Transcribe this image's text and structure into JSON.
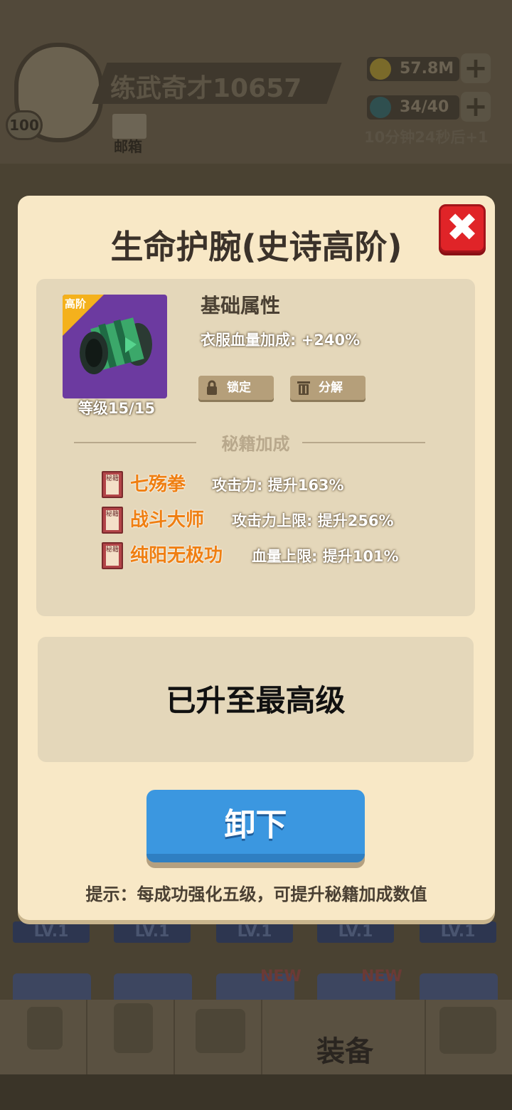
{
  "hud": {
    "player_name": "练武奇才10657",
    "level": "100",
    "mail_label": "邮箱",
    "coins": "57.8M",
    "energy": "34/40",
    "energy_timer": "10分钟24秒后+1",
    "plus": "+"
  },
  "background": {
    "lv_chips": [
      "LV.1",
      "LV.1",
      "LV.1",
      "LV.1",
      "LV.1"
    ],
    "new_tags": [
      "NEW",
      "NEW"
    ],
    "nav_active_label": "装备"
  },
  "dialog": {
    "title": "生命护腕(史诗高阶)",
    "close_icon": "close-x-icon",
    "item": {
      "tier_badge": "高阶",
      "level": "等级15/15",
      "icon": "bracer-icon"
    },
    "base_attr": {
      "heading": "基础属性",
      "stat": "衣服血量加成: +240%"
    },
    "buttons": {
      "lock": "锁定",
      "decompose": "分解",
      "unequip": "卸下"
    },
    "secret": {
      "heading": "秘籍加成",
      "book_label": "秘籍",
      "rows": [
        {
          "name": "七殇拳",
          "effect": "攻击力: 提升163%"
        },
        {
          "name": "战斗大师",
          "effect": "攻击力上限: 提升256%"
        },
        {
          "name": "纯阳无极功",
          "effect": "血量上限: 提升101%"
        }
      ]
    },
    "max_level_text": "已升至最高级",
    "tip": "提示：每成功强化五级，可提升秘籍加成数值"
  },
  "colors": {
    "dialog_bg": "#f8e8c6",
    "panel_bg": "#e4d7ba",
    "accent_orange": "#ef7f12",
    "button_blue": "#3b97e0",
    "close_red": "#e02428",
    "item_purple": "#6c3aa0",
    "tier_gold": "#f4b11c"
  }
}
